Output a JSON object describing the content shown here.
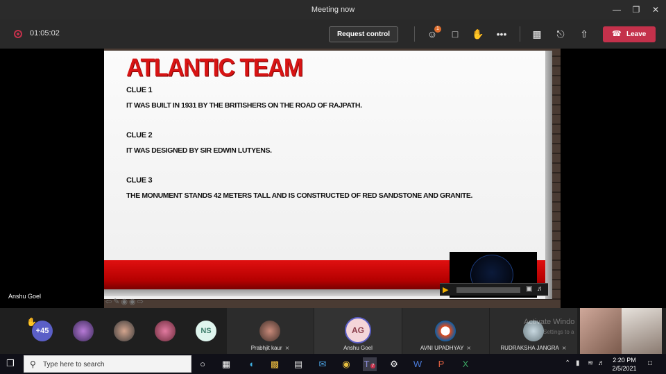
{
  "window": {
    "title": "Meeting now"
  },
  "toolbar": {
    "timer": "01:05:02",
    "request_control": "Request control",
    "participants_badge": "1",
    "leave": "Leave"
  },
  "slide": {
    "title": "ATLANTIC TEAM",
    "clues": [
      {
        "heading": "CLUE 1",
        "text": "IT WAS BUILT IN 1931 BY THE BRITISHERS ON THE ROAD OF RAJPATH."
      },
      {
        "heading": "CLUE 2",
        "text": " IT WAS DESIGNED BY SIR EDWIN LUTYENS."
      },
      {
        "heading": "CLUE  3",
        "text": "THE MONUMENT STANDS 42 METERS TALL  AND IS CONSTRUCTED OF RED SANDSTONE AND GRANITE."
      }
    ],
    "colors": {
      "title": "#d81414",
      "band": "#c00000"
    }
  },
  "presenter": {
    "name": "Anshu Goel"
  },
  "participants": {
    "overflow": "+45",
    "initials_ns": "NS",
    "tiles": [
      {
        "name": "Prabhjit kaur"
      },
      {
        "name": "Anshu Goel",
        "initials": "AG"
      },
      {
        "name": "AVNI UPADHYAY"
      },
      {
        "name": "RUDRAKSHA JANGRA"
      }
    ]
  },
  "activation": {
    "line1": "Activate Windo",
    "line2": "Settings to a"
  },
  "taskbar": {
    "search_placeholder": "Type here to search",
    "teams_badge": "7",
    "time": "2:20 PM",
    "date": "2/5/2021"
  }
}
